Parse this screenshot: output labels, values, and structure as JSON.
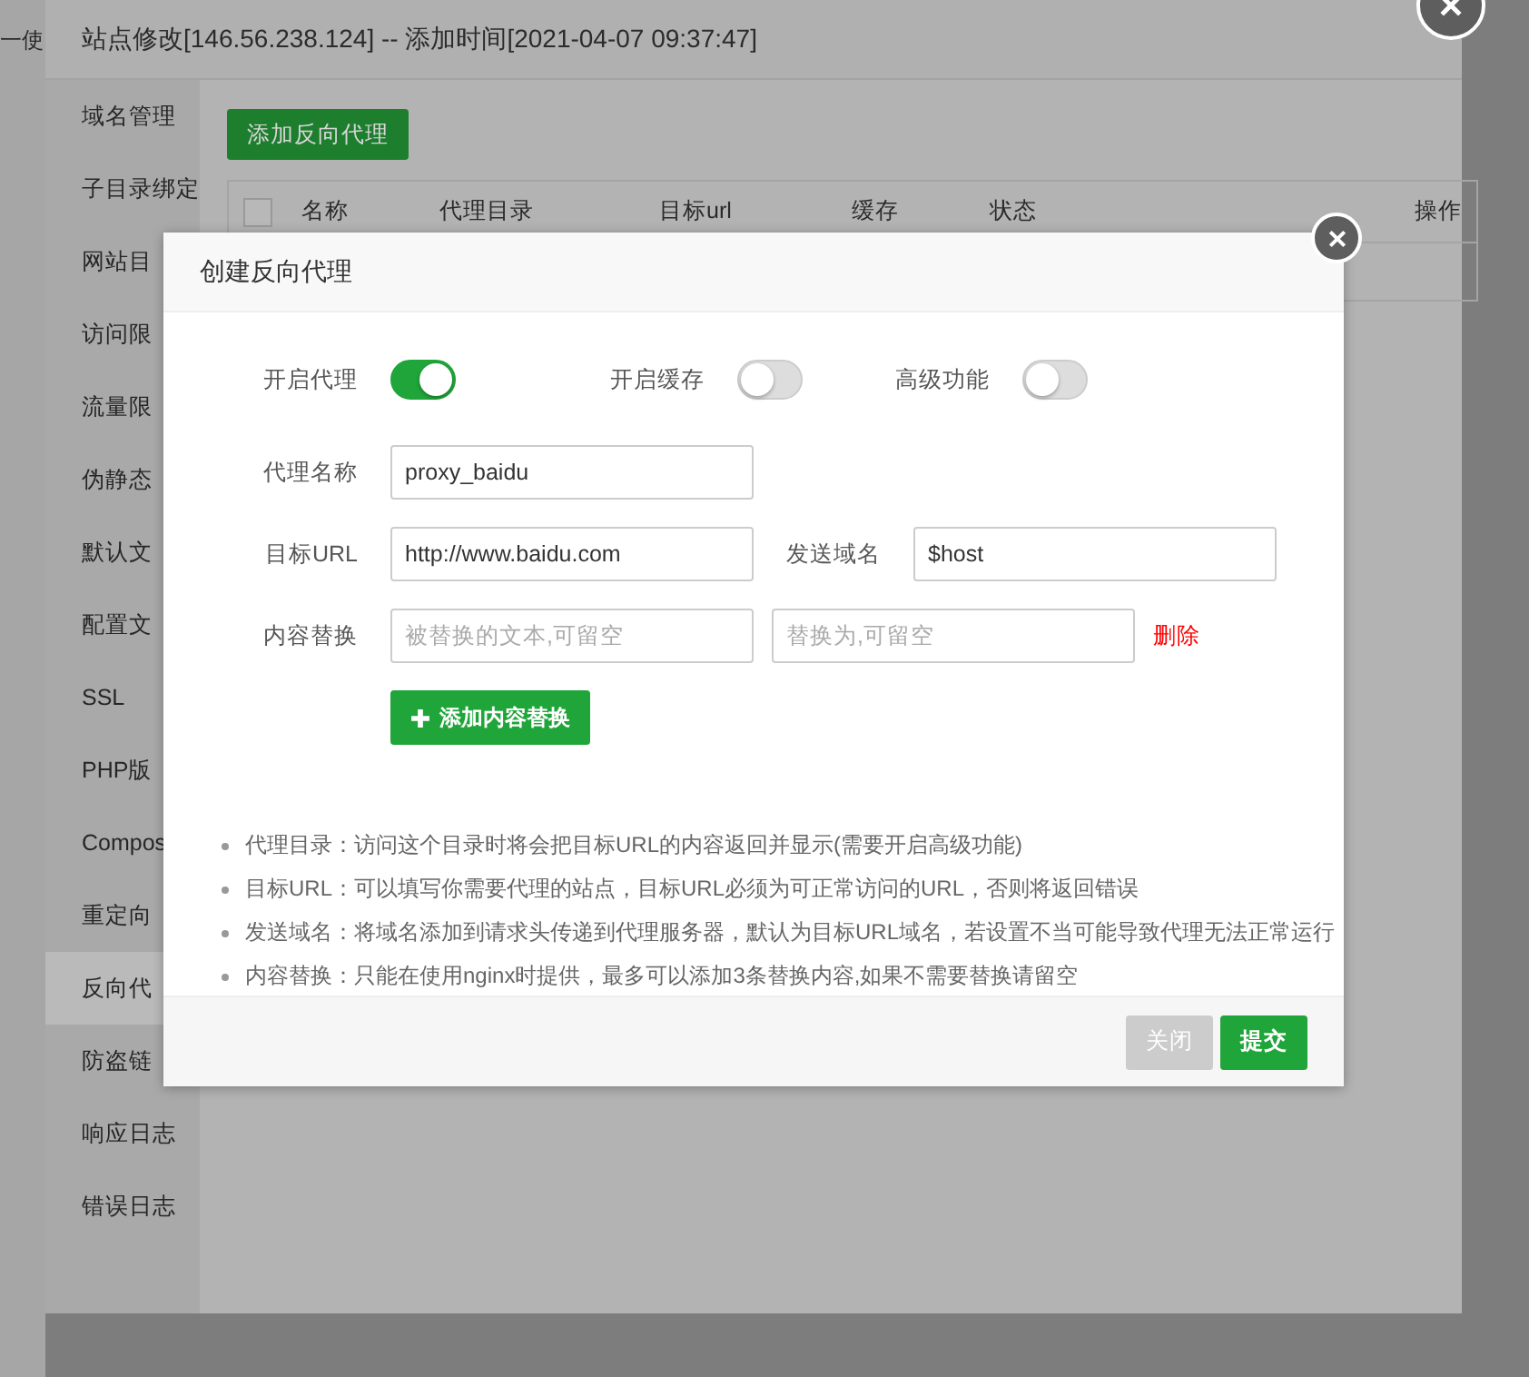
{
  "background_page": {
    "text": "一使"
  },
  "site_dialog": {
    "title": "站点修改[146.56.238.124] -- 添加时间[2021-04-07 09:37:47]",
    "sidebar": [
      {
        "label": "域名管理",
        "selected": false
      },
      {
        "label": "子目录绑定",
        "selected": false
      },
      {
        "label": "网站目",
        "selected": false
      },
      {
        "label": "访问限",
        "selected": false
      },
      {
        "label": "流量限",
        "selected": false
      },
      {
        "label": "伪静态",
        "selected": false
      },
      {
        "label": "默认文",
        "selected": false
      },
      {
        "label": "配置文",
        "selected": false
      },
      {
        "label": "SSL",
        "selected": false
      },
      {
        "label": "PHP版",
        "selected": false
      },
      {
        "label": "Compos",
        "selected": false
      },
      {
        "label": "重定向",
        "selected": false
      },
      {
        "label": "反向代",
        "selected": true
      },
      {
        "label": "防盗链",
        "selected": false
      },
      {
        "label": "响应日志",
        "selected": false
      },
      {
        "label": "错误日志",
        "selected": false
      }
    ],
    "add_button": "添加反向代理",
    "table": {
      "select_all_checked": false,
      "columns": [
        "名称",
        "代理目录",
        "目标url",
        "缓存",
        "状态",
        "操作"
      ]
    }
  },
  "proxy_dialog": {
    "title": "创建反向代理",
    "toggles": [
      {
        "label": "开启代理",
        "on": true
      },
      {
        "label": "开启缓存",
        "on": false
      },
      {
        "label": "高级功能",
        "on": false
      }
    ],
    "proxy_name": {
      "label": "代理名称",
      "value": "proxy_baidu"
    },
    "target_url": {
      "label": "目标URL",
      "value": "http://www.baidu.com"
    },
    "send_host": {
      "label": "发送域名",
      "value": "$host"
    },
    "replace": {
      "label": "内容替换",
      "from_placeholder": "被替换的文本,可留空",
      "to_placeholder": "替换为,可留空",
      "delete": "删除"
    },
    "add_replace_button": "添加内容替换",
    "notes": [
      "代理目录：访问这个目录时将会把目标URL的内容返回并显示(需要开启高级功能)",
      "目标URL：可以填写你需要代理的站点，目标URL必须为可正常访问的URL，否则将返回错误",
      "发送域名：将域名添加到请求头传递到代理服务器，默认为目标URL域名，若设置不当可能导致代理无法正常运行",
      "内容替换：只能在使用nginx时提供，最多可以添加3条替换内容,如果不需要替换请留空"
    ],
    "buttons": [
      {
        "label": "关闭",
        "kind": "secondary"
      },
      {
        "label": "提交",
        "kind": "primary"
      }
    ]
  }
}
